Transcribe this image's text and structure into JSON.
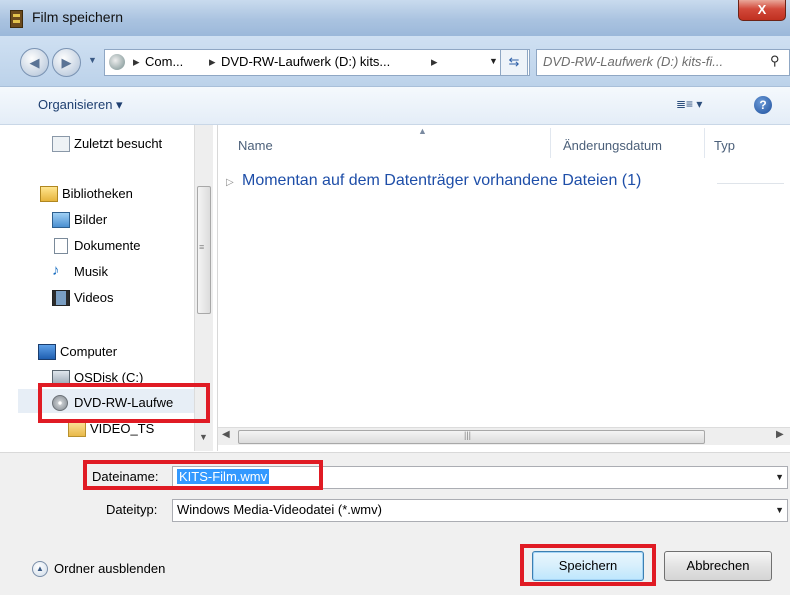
{
  "window": {
    "title": "Film speichern",
    "close_label": "X"
  },
  "address": {
    "segments": [
      "Com...",
      "DVD-RW-Laufwerk (D:) kits...",
      "▸"
    ],
    "search_placeholder": "DVD-RW-Laufwerk (D:) kits-fi..."
  },
  "toolbar": {
    "organize_label": "Organisieren ▾",
    "view_label": "≣≡ ▾",
    "help_label": "?"
  },
  "nav": {
    "items": [
      {
        "label": "Zuletzt besucht",
        "icon": "recent-places-icon"
      },
      {
        "label": "Bibliotheken",
        "icon": "libraries-icon"
      },
      {
        "label": "Bilder",
        "icon": "pictures-icon"
      },
      {
        "label": "Dokumente",
        "icon": "documents-icon"
      },
      {
        "label": "Musik",
        "icon": "music-icon"
      },
      {
        "label": "Videos",
        "icon": "videos-icon"
      },
      {
        "label": "Computer",
        "icon": "computer-icon"
      },
      {
        "label": "OSDisk (C:)",
        "icon": "hard-disk-icon"
      },
      {
        "label": "DVD-RW-Laufwe",
        "icon": "dvd-drive-icon"
      },
      {
        "label": "VIDEO_TS",
        "icon": "folder-icon"
      }
    ]
  },
  "list": {
    "columns": [
      "Name",
      "Änderungsdatum",
      "Typ"
    ],
    "group_label": "Momentan auf dem Datenträger vorhandene Dateien (1)"
  },
  "form": {
    "filename_label": "Dateiname:",
    "filename_value": "KITS-Film.wmv",
    "filetype_label": "Dateityp:",
    "filetype_value": "Windows Media-Videodatei (*.wmv)"
  },
  "footer": {
    "hide_folders_label": "Ordner ausblenden",
    "save_label": "Speichern",
    "cancel_label": "Abbrechen"
  },
  "colors": {
    "highlight_box": "#e01b24",
    "link_blue": "#1e4ea8",
    "selection": "#3399ff"
  }
}
